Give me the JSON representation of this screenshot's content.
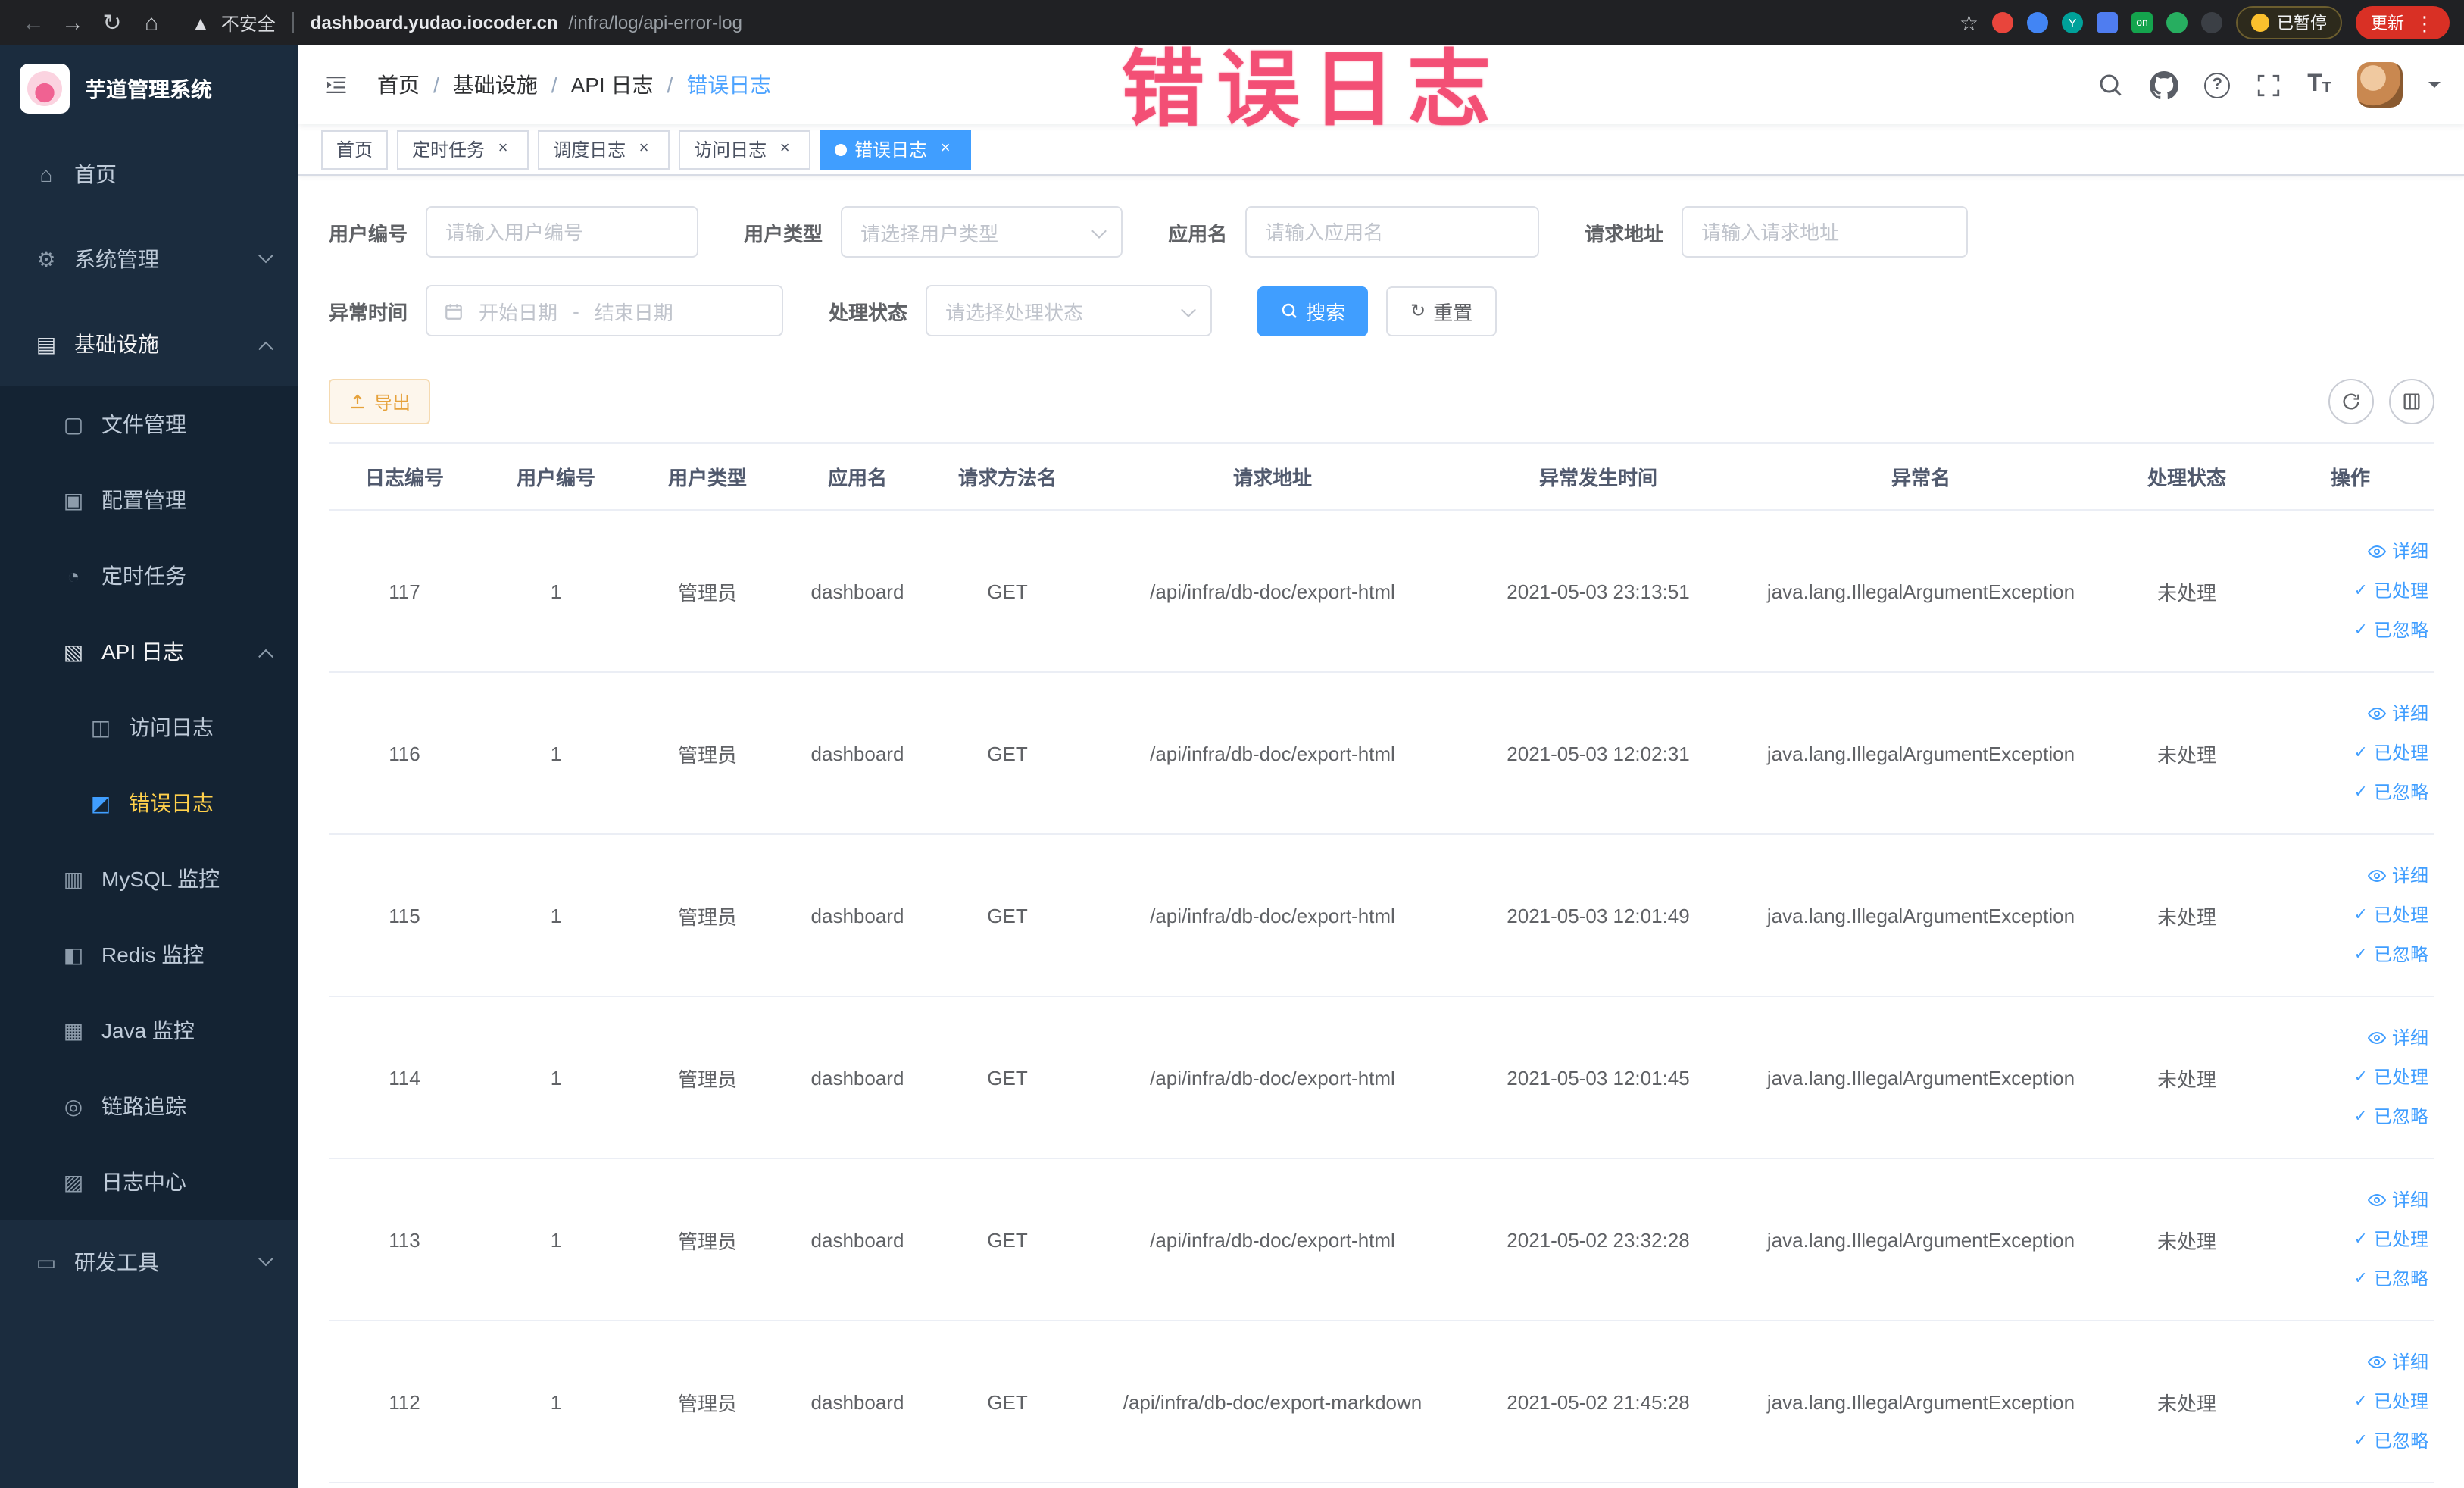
{
  "colors": {
    "accent": "#409eff",
    "warning": "#e6a23c",
    "annotation_pink": "#f2466e",
    "sidebar_bg": "#1b2c3e",
    "sidebar_sub_bg": "#142333",
    "browser_bar_bg": "#202124",
    "active_menu_text": "#ffd04b",
    "active_tab_bg": "#409eff"
  },
  "annotation": {
    "text": "错误日志"
  },
  "browser": {
    "security_label": "不安全",
    "url": "dashboard.yudao.iocoder.cn/infra/log/api-error-log",
    "paused_badge": "已暂停",
    "update_button": "更新",
    "extensions": {
      "y_label": "Y",
      "on_label": "on"
    }
  },
  "sidebar": {
    "logo_title": "芋道管理系统",
    "menu": [
      {
        "key": "home",
        "label": "首页",
        "icon": "home-icon",
        "level": 1
      },
      {
        "key": "system",
        "label": "系统管理",
        "icon": "gear-icon",
        "level": 1,
        "arrow": "down"
      },
      {
        "key": "infra",
        "label": "基础设施",
        "icon": "infra-icon",
        "level": 1,
        "arrow": "up",
        "open": true
      },
      {
        "key": "file",
        "label": "文件管理",
        "icon": "file-icon",
        "level": 2
      },
      {
        "key": "config",
        "label": "配置管理",
        "icon": "config-icon",
        "level": 2
      },
      {
        "key": "job",
        "label": "定时任务",
        "icon": "job-icon",
        "level": 2
      },
      {
        "key": "api-log",
        "label": "API 日志",
        "icon": "api-log-icon",
        "level": 2,
        "arrow": "up",
        "open": true
      },
      {
        "key": "access-log",
        "label": "访问日志",
        "icon": "access-log-icon",
        "level": 3
      },
      {
        "key": "error-log",
        "label": "错误日志",
        "icon": "error-log-icon",
        "level": 3,
        "active": true
      },
      {
        "key": "mysql",
        "label": "MySQL 监控",
        "icon": "mysql-icon",
        "level": 2
      },
      {
        "key": "redis",
        "label": "Redis 监控",
        "icon": "redis-icon",
        "level": 2
      },
      {
        "key": "java",
        "label": "Java 监控",
        "icon": "java-icon",
        "level": 2
      },
      {
        "key": "trace",
        "label": "链路追踪",
        "icon": "trace-icon",
        "level": 2
      },
      {
        "key": "log-center",
        "label": "日志中心",
        "icon": "log-center-icon",
        "level": 2
      },
      {
        "key": "dev-tools",
        "label": "研发工具",
        "icon": "tools-icon",
        "level": 1,
        "arrow": "down"
      }
    ]
  },
  "navbar": {
    "breadcrumb": [
      "首页",
      "基础设施",
      "API 日志",
      "错误日志"
    ]
  },
  "tabs": [
    {
      "label": "首页",
      "closable": false,
      "active": false
    },
    {
      "label": "定时任务",
      "closable": true,
      "active": false
    },
    {
      "label": "调度日志",
      "closable": true,
      "active": false
    },
    {
      "label": "访问日志",
      "closable": true,
      "active": false
    },
    {
      "label": "错误日志",
      "closable": true,
      "active": true
    }
  ],
  "filters": {
    "user_id": {
      "label": "用户编号",
      "placeholder": "请输入用户编号"
    },
    "user_type": {
      "label": "用户类型",
      "placeholder": "请选择用户类型"
    },
    "app_name": {
      "label": "应用名",
      "placeholder": "请输入应用名"
    },
    "request_url": {
      "label": "请求地址",
      "placeholder": "请输入请求地址"
    },
    "exception_time": {
      "label": "异常时间",
      "start_placeholder": "开始日期",
      "separator": "-",
      "end_placeholder": "结束日期"
    },
    "process_status": {
      "label": "处理状态",
      "placeholder": "请选择处理状态"
    },
    "search_button": "搜索",
    "reset_button": "重置"
  },
  "toolbar": {
    "export_button": "导出"
  },
  "table": {
    "columns": [
      "日志编号",
      "用户编号",
      "用户类型",
      "应用名",
      "请求方法名",
      "请求地址",
      "异常发生时间",
      "异常名",
      "处理状态",
      "操作"
    ],
    "action_labels": [
      "详细",
      "已处理",
      "已忽略"
    ],
    "rows": [
      {
        "log_id": "117",
        "user_id": "1",
        "user_type": "管理员",
        "app_name": "dashboard",
        "method": "GET",
        "url": "/api/infra/db-doc/export-html",
        "time": "2021-05-03 23:13:51",
        "exception": "java.lang.IllegalArgumentException",
        "status": "未处理"
      },
      {
        "log_id": "116",
        "user_id": "1",
        "user_type": "管理员",
        "app_name": "dashboard",
        "method": "GET",
        "url": "/api/infra/db-doc/export-html",
        "time": "2021-05-03 12:02:31",
        "exception": "java.lang.IllegalArgumentException",
        "status": "未处理"
      },
      {
        "log_id": "115",
        "user_id": "1",
        "user_type": "管理员",
        "app_name": "dashboard",
        "method": "GET",
        "url": "/api/infra/db-doc/export-html",
        "time": "2021-05-03 12:01:49",
        "exception": "java.lang.IllegalArgumentException",
        "status": "未处理"
      },
      {
        "log_id": "114",
        "user_id": "1",
        "user_type": "管理员",
        "app_name": "dashboard",
        "method": "GET",
        "url": "/api/infra/db-doc/export-html",
        "time": "2021-05-03 12:01:45",
        "exception": "java.lang.IllegalArgumentException",
        "status": "未处理"
      },
      {
        "log_id": "113",
        "user_id": "1",
        "user_type": "管理员",
        "app_name": "dashboard",
        "method": "GET",
        "url": "/api/infra/db-doc/export-html",
        "time": "2021-05-02 23:32:28",
        "exception": "java.lang.IllegalArgumentException",
        "status": "未处理"
      },
      {
        "log_id": "112",
        "user_id": "1",
        "user_type": "管理员",
        "app_name": "dashboard",
        "method": "GET",
        "url": "/api/infra/db-doc/export-markdown",
        "time": "2021-05-02 21:45:28",
        "exception": "java.lang.IllegalArgumentException",
        "status": "未处理"
      }
    ]
  }
}
